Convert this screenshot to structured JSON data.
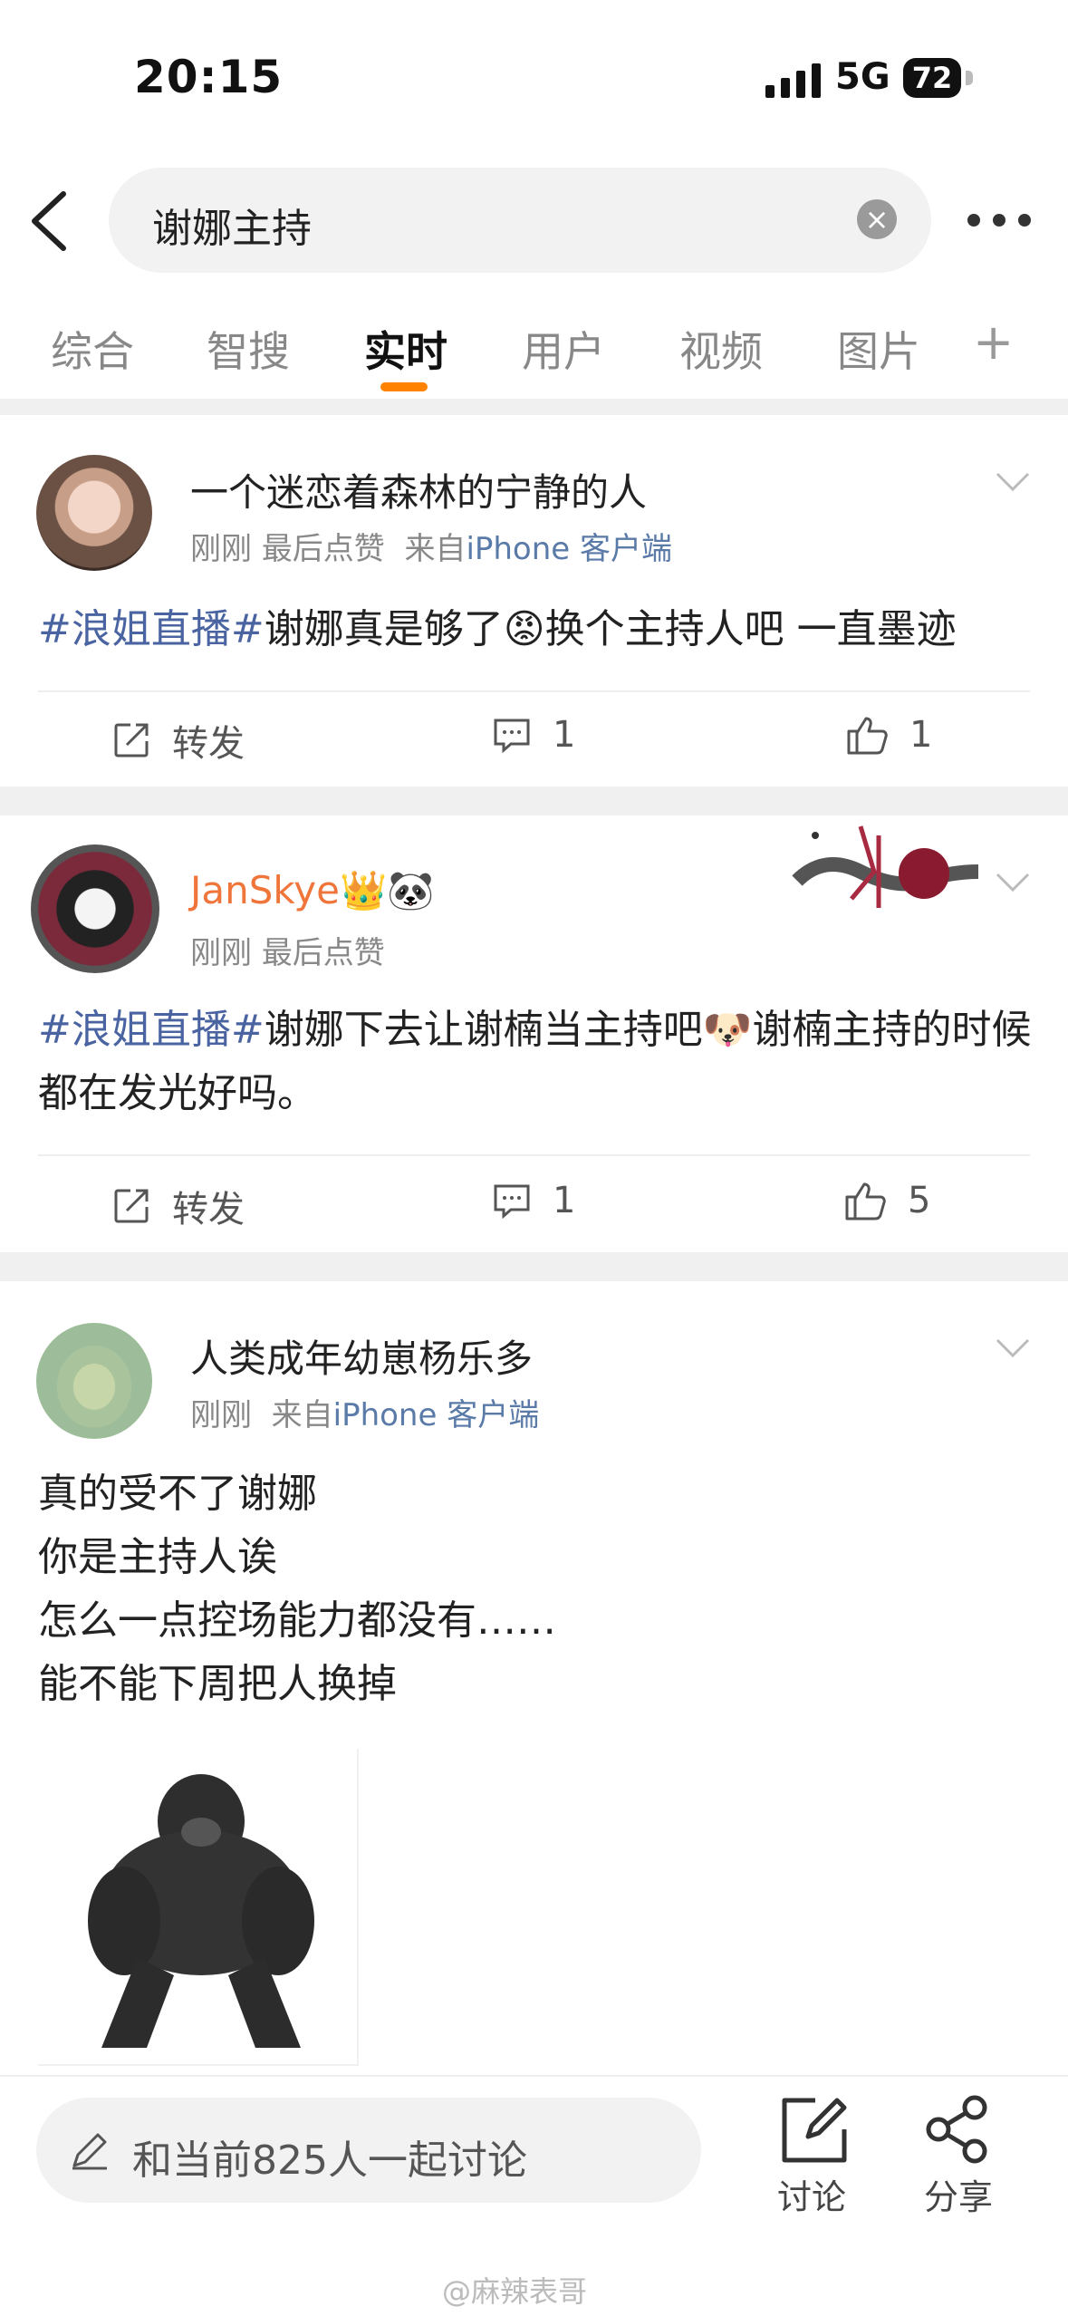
{
  "status_bar": {
    "time": "20:15",
    "network": "5G",
    "battery": "72"
  },
  "search": {
    "query": "谢娜主持"
  },
  "tabs": [
    {
      "label": "综合",
      "active": false
    },
    {
      "label": "智搜",
      "active": false
    },
    {
      "label": "实时",
      "active": true
    },
    {
      "label": "用户",
      "active": false
    },
    {
      "label": "视频",
      "active": false
    },
    {
      "label": "图片",
      "active": false
    }
  ],
  "tab_more": "+",
  "posts": [
    {
      "username": "一个迷恋着森林的宁静的人",
      "time": "刚刚",
      "liked": "最后点赞",
      "source_prefix": "来自",
      "source": "iPhone 客户端",
      "tag": "#浪姐直播#",
      "text": "谢娜真是够了😡换个主持人吧 一直墨迹",
      "repost_label": "转发",
      "comments": "1",
      "likes": "1"
    },
    {
      "username": "JanSkye",
      "badges": "👑🐼",
      "time": "刚刚",
      "liked": "最后点赞",
      "tag": "#浪姐直播#",
      "text": "谢娜下去让谢楠当主持吧🐶谢楠主持的时候都在发光好吗。",
      "repost_label": "转发",
      "comments": "1",
      "likes": "5"
    },
    {
      "username": "人类成年幼崽杨乐多",
      "time": "刚刚",
      "source_prefix": "来自",
      "source": "iPhone 客户端",
      "lines": [
        "真的受不了谢娜",
        "你是主持人诶",
        "怎么一点控场能力都没有……",
        "能不能下周把人换掉"
      ]
    }
  ],
  "bottom_bar": {
    "comment_placeholder": "和当前825人一起讨论",
    "discuss_label": "讨论",
    "share_label": "分享"
  },
  "watermark": "@麻辣表哥",
  "colors": {
    "accent": "#ff8200",
    "link": "#4a64a2",
    "username_orange": "#f0753a"
  }
}
